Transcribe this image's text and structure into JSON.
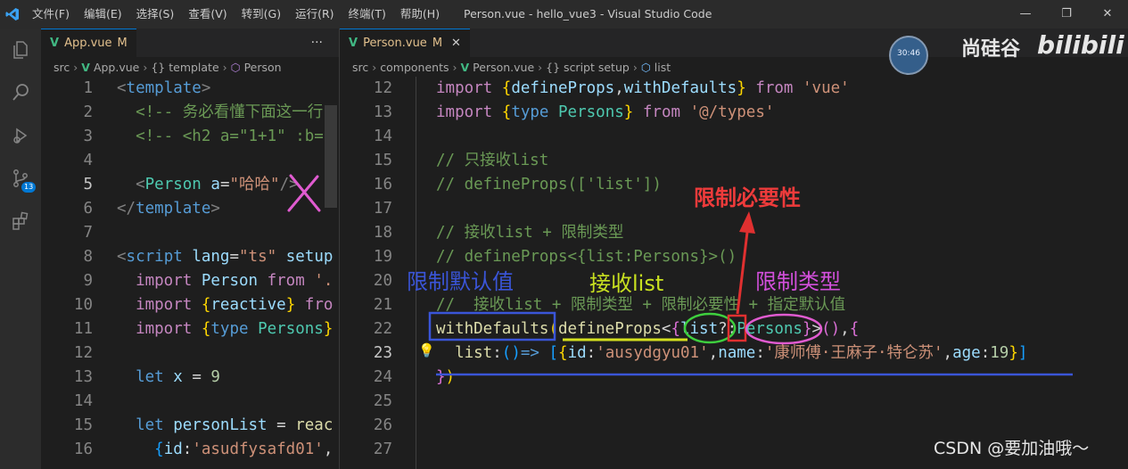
{
  "titlebar": {
    "menu": [
      "文件(F)",
      "编辑(E)",
      "选择(S)",
      "查看(V)",
      "转到(G)",
      "运行(R)",
      "终端(T)",
      "帮助(H)"
    ],
    "title": "Person.vue - hello_vue3 - Visual Studio Code"
  },
  "activity": {
    "scm_badge": "13"
  },
  "left": {
    "tab": {
      "name": "App.vue",
      "modified": "M"
    },
    "breadcrumb": [
      "src",
      "App.vue",
      "{} template",
      "Person"
    ],
    "lines": [
      {
        "n": "1",
        "html": "<span class='punc'>&lt;</span><span class='tag'>template</span><span class='punc'>&gt;</span>"
      },
      {
        "n": "2",
        "html": "  <span class='cmt'>&lt;!-- 务必看懂下面这一行</span>"
      },
      {
        "n": "3",
        "html": "  <span class='cmt'>&lt;!-- &lt;h2 a=\"1+1\" :b=\"</span>"
      },
      {
        "n": "4",
        "html": ""
      },
      {
        "n": "5",
        "html": "  <span class='punc'>&lt;</span><span class='ty'>Person</span> <span class='attr'>a</span><span class='plain'>=</span><span class='str'>\"哈哈\"</span><span class='punc'>/&gt;</span>",
        "cur": true
      },
      {
        "n": "6",
        "html": "<span class='punc'>&lt;/</span><span class='tag'>template</span><span class='punc'>&gt;</span>"
      },
      {
        "n": "7",
        "html": ""
      },
      {
        "n": "8",
        "html": "<span class='punc'>&lt;</span><span class='tag'>script</span> <span class='attr'>lang</span><span class='plain'>=</span><span class='str'>\"ts\"</span> <span class='attr'>setup</span>"
      },
      {
        "n": "9",
        "html": "  <span class='kw'>import</span> <span class='var'>Person</span> <span class='kw'>from</span> <span class='str'>'.</span>"
      },
      {
        "n": "10",
        "html": "  <span class='kw'>import</span> <span class='brace2'>{</span><span class='var'>reactive</span><span class='brace2'>}</span> <span class='kw'>fro</span>"
      },
      {
        "n": "11",
        "html": "  <span class='kw'>import</span> <span class='brace2'>{</span><span class='kw2'>type</span> <span class='ty'>Persons</span><span class='brace2'>}</span>"
      },
      {
        "n": "12",
        "html": ""
      },
      {
        "n": "13",
        "html": "  <span class='kw2'>let</span> <span class='var'>x</span> <span class='plain'>=</span> <span class='num'>9</span>"
      },
      {
        "n": "14",
        "html": ""
      },
      {
        "n": "15",
        "html": "  <span class='kw2'>let</span> <span class='var'>personList</span> <span class='plain'>=</span> <span class='fn'>reac</span>"
      },
      {
        "n": "16",
        "html": "    <span class='brace3'>{</span><span class='var'>id</span><span class='plain'>:</span><span class='str'>'asudfysafd01'</span><span class='plain'>,</span>"
      }
    ]
  },
  "right": {
    "tab": {
      "name": "Person.vue",
      "modified": "M"
    },
    "breadcrumb": [
      "src",
      "components",
      "Person.vue",
      "{} script setup",
      "list"
    ],
    "lines": [
      {
        "n": "12",
        "html": "<span class='kw'>import</span> <span class='brace2'>{</span><span class='var'>defineProps</span><span class='plain'>,</span><span class='var'>withDefaults</span><span class='brace2'>}</span> <span class='kw'>from</span> <span class='str'>'vue'</span>"
      },
      {
        "n": "13",
        "html": "<span class='kw'>import</span> <span class='brace2'>{</span><span class='kw2'>type</span> <span class='ty'>Persons</span><span class='brace2'>}</span> <span class='kw'>from</span> <span class='str'>'@/types'</span>"
      },
      {
        "n": "14",
        "html": ""
      },
      {
        "n": "15",
        "html": "<span class='cmt'>// 只接收list</span>"
      },
      {
        "n": "16",
        "html": "<span class='cmt'>// defineProps(['list'])</span>"
      },
      {
        "n": "17",
        "html": ""
      },
      {
        "n": "18",
        "html": "<span class='cmt'>// 接收list + 限制类型</span>"
      },
      {
        "n": "19",
        "html": "<span class='cmt'>// defineProps&lt;{list:Persons}&gt;()</span>"
      },
      {
        "n": "20",
        "html": ""
      },
      {
        "n": "21",
        "html": "<span class='cmt'>//  接收list + 限制类型 + 限制必要性 + 指定默认值</span>"
      },
      {
        "n": "22",
        "html": "<span class='fn'>withDefaults</span><span class='brace2'>(</span><span class='fn'>defineProps</span><span class='plain'>&lt;</span><span class='brace'>{</span><span class='var'>list</span><span class='plain'>?:</span><span class='ty'>Persons</span><span class='brace'>}</span><span class='plain'>&gt;</span><span class='brace'>()</span><span class='plain'>,</span><span class='brace'>{</span>"
      },
      {
        "n": "23",
        "html": "  <span class='fn'>list</span><span class='plain'>:</span><span class='brace3'>()</span><span class='kw2'>=&gt;</span> <span class='brace3'>[</span><span class='brace2'>{</span><span class='var'>id</span><span class='plain'>:</span><span class='str'>'ausydgyu01'</span><span class='plain'>,</span><span class='var'>name</span><span class='plain'>:</span><span class='str'>'康师傅·王麻子·特仑苏'</span><span class='plain'>,</span><span class='var'>age</span><span class='plain'>:</span><span class='num'>19</span><span class='brace2'>}</span><span class='brace3'>]</span>",
        "cur": true
      },
      {
        "n": "24",
        "html": "<span class='brace'>}</span><span class='brace2'>)</span>"
      },
      {
        "n": "25",
        "html": ""
      },
      {
        "n": "26",
        "html": ""
      },
      {
        "n": "27",
        "html": ""
      }
    ]
  },
  "annotations": {
    "required": "限制必要性",
    "defaults": "限制默认值",
    "receive": "接收list",
    "type": "限制类型"
  },
  "watermark": {
    "brand": "尚硅谷",
    "site": "bilibili",
    "clock": "30:46",
    "csdn": "CSDN @要加油哦～"
  }
}
